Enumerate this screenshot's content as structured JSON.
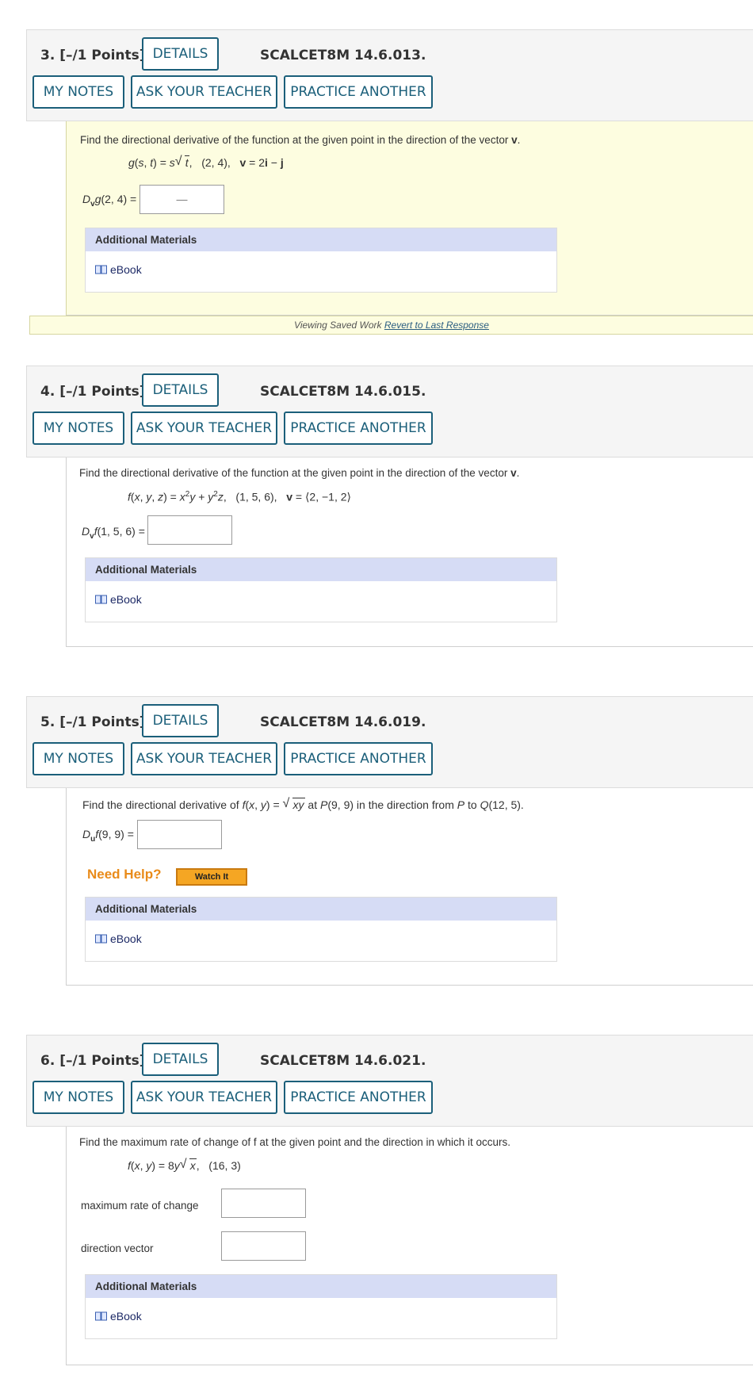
{
  "buttons": {
    "details": "DETAILS",
    "my_notes": "MY NOTES",
    "ask_teacher": "ASK YOUR TEACHER",
    "practice": "PRACTICE ANOTHER"
  },
  "common": {
    "additional_materials": "Additional Materials",
    "ebook": "eBook"
  },
  "q3": {
    "title": "3.  [–/1 Points]",
    "code": "SCALCET8M 14.6.013.",
    "prompt_pre": "Find the directional derivative of the function at the given point in the direction of the vector ",
    "prompt_bold": "v",
    "prompt_post": ".",
    "answer_label": "(2, 4) =",
    "answer_value": "—",
    "saved_text": "Viewing Saved Work ",
    "revert_link": "Revert to Last Response"
  },
  "q4": {
    "title": "4.  [–/1 Points]",
    "code": "SCALCET8M 14.6.015.",
    "prompt_pre": "Find the directional derivative of the function at the given point in the direction of the vector ",
    "prompt_bold": "v",
    "prompt_post": ".",
    "answer_label": "(1, 5, 6) ="
  },
  "q5": {
    "title": "5.  [–/1 Points]",
    "code": "SCALCET8M 14.6.019.",
    "answer_label": "(9, 9) =",
    "need_help": "Need Help?",
    "watch_it": "Watch It"
  },
  "q6": {
    "title": "6.  [–/1 Points]",
    "code": "SCALCET8M 14.6.021.",
    "prompt": "Find the maximum rate of change of f at the given point and the direction in which it occurs.",
    "max_rate_label": "maximum rate of change",
    "direction_label": "direction vector"
  }
}
